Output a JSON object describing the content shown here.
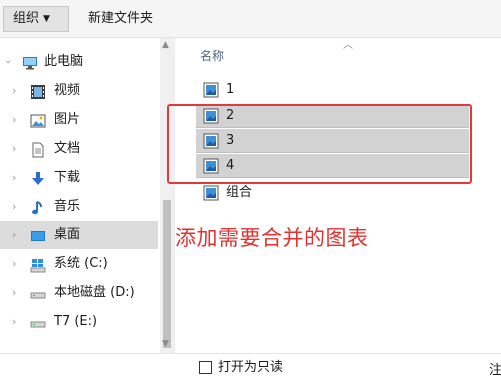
{
  "toolbar": {
    "organize_label": "组织",
    "new_folder_label": "新建文件夹"
  },
  "nav": {
    "items": [
      {
        "label": "此电脑",
        "icon": "computer-icon"
      },
      {
        "label": "视频",
        "icon": "video-icon"
      },
      {
        "label": "图片",
        "icon": "picture-icon"
      },
      {
        "label": "文档",
        "icon": "document-icon"
      },
      {
        "label": "下载",
        "icon": "download-icon"
      },
      {
        "label": "音乐",
        "icon": "music-icon"
      },
      {
        "label": "桌面",
        "icon": "desktop-icon"
      },
      {
        "label": "系统 (C:)",
        "icon": "windows-drive-icon"
      },
      {
        "label": "本地磁盘 (D:)",
        "icon": "drive-icon"
      },
      {
        "label": "T7 (E:)",
        "icon": "drive-icon"
      }
    ]
  },
  "file_list": {
    "column_header": "名称",
    "files": [
      {
        "name": "1",
        "selected": false
      },
      {
        "name": "2",
        "selected": true
      },
      {
        "name": "3",
        "selected": true
      },
      {
        "name": "4",
        "selected": true
      },
      {
        "name": "组合",
        "selected": false
      }
    ]
  },
  "annotation": "添加需要合并的图表",
  "footer": {
    "readonly_label": "打开为只读",
    "corner_text": "注"
  },
  "colors": {
    "annotation": "#e0322f",
    "selection": "#d2d2d2",
    "nav_selected": "#dcdcdc"
  }
}
